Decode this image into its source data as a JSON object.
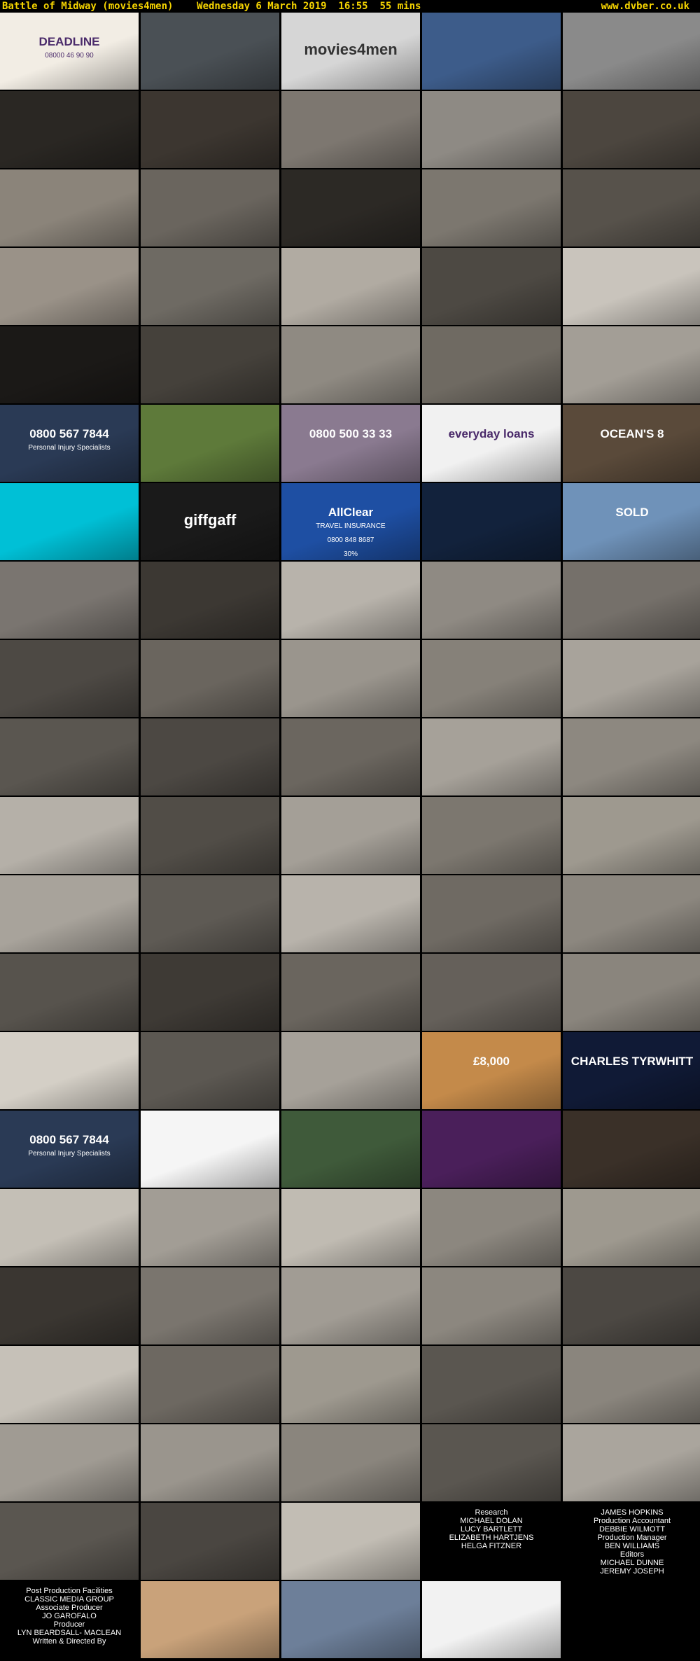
{
  "header": {
    "left": "Battle of Midway (movies4men)    Wednesday 6 March 2019  16:55  55 mins",
    "right": "www.dvber.co.uk"
  },
  "tiles": [
    {
      "bg": "#f2ede4",
      "kind": "deadline",
      "text": [
        "DEADLINE",
        "08000 46 90 90"
      ]
    },
    {
      "bg": "#4a5055"
    },
    {
      "bg": "#d6d6d6",
      "kind": "logo",
      "text": [
        "movies4men"
      ]
    },
    {
      "bg": "#3d5c8a"
    },
    {
      "bg": "#8a8a8a"
    },
    {
      "bg": "#2a2723"
    },
    {
      "bg": "#3c3630"
    },
    {
      "bg": "#7d7770"
    },
    {
      "bg": "#8e8a84"
    },
    {
      "bg": "#4c463f"
    },
    {
      "bg": "#8b847a"
    },
    {
      "bg": "#6a655e"
    },
    {
      "bg": "#2c2925"
    },
    {
      "bg": "#7c776f"
    },
    {
      "bg": "#57524b"
    },
    {
      "bg": "#9a9288"
    },
    {
      "bg": "#6e6a63"
    },
    {
      "bg": "#b1aba2"
    },
    {
      "bg": "#4d4943"
    },
    {
      "bg": "#c9c4bc"
    },
    {
      "bg": "#1b1917"
    },
    {
      "bg": "#45413b"
    },
    {
      "bg": "#8f8a82"
    },
    {
      "bg": "#6f6a62"
    },
    {
      "bg": "#a39e96"
    },
    {
      "bg": "#2a3a55",
      "kind": "phone",
      "text": [
        "0800 567 7844",
        "Personal Injury Specialists"
      ]
    },
    {
      "bg": "#5e7a3a"
    },
    {
      "bg": "#8a7a90",
      "kind": "cap",
      "text": [
        "0800 500 33 33"
      ]
    },
    {
      "bg": "#f1f1f1",
      "kind": "green",
      "text": [
        "everyday loans"
      ]
    },
    {
      "bg": "#5a4a3a",
      "kind": "cap",
      "text": [
        "OCEAN'S 8"
      ]
    },
    {
      "bg": "#00c0d6"
    },
    {
      "bg": "#1a1a1a",
      "kind": "logo",
      "text": [
        "giffgaff"
      ]
    },
    {
      "bg": "#1e4fa3",
      "kind": "allclear",
      "text": [
        "AllClear",
        "TRAVEL INSURANCE",
        "0800 848 8687",
        "30%"
      ]
    },
    {
      "bg": "#12223c"
    },
    {
      "bg": "#6f92b9",
      "kind": "cap",
      "text": [
        "SOLD"
      ]
    },
    {
      "bg": "#7a7570"
    },
    {
      "bg": "#3c3833"
    },
    {
      "bg": "#b8b3ab"
    },
    {
      "bg": "#8f8a83"
    },
    {
      "bg": "#75706a"
    },
    {
      "bg": "#4d4944"
    },
    {
      "bg": "#6a655e"
    },
    {
      "bg": "#9a958d"
    },
    {
      "bg": "#868179"
    },
    {
      "bg": "#a8a39b"
    },
    {
      "bg": "#5a5650"
    },
    {
      "bg": "#4c4843"
    },
    {
      "bg": "#6b665f"
    },
    {
      "bg": "#a6a199"
    },
    {
      "bg": "#8d8880"
    },
    {
      "bg": "#b5b0a8"
    },
    {
      "bg": "#514d47"
    },
    {
      "bg": "#a49f97"
    },
    {
      "bg": "#7c776f"
    },
    {
      "bg": "#9e998f"
    },
    {
      "bg": "#a8a39b"
    },
    {
      "bg": "#5e5a54"
    },
    {
      "bg": "#b8b3ab"
    },
    {
      "bg": "#6f6a63"
    },
    {
      "bg": "#8c877f"
    },
    {
      "bg": "#57534d"
    },
    {
      "bg": "#3e3a35"
    },
    {
      "bg": "#6a655e"
    },
    {
      "bg": "#65605a"
    },
    {
      "bg": "#8a857d"
    },
    {
      "bg": "#d4cfc6"
    },
    {
      "bg": "#5c5852"
    },
    {
      "bg": "#a6a199"
    },
    {
      "bg": "#c48a4a",
      "kind": "cap",
      "text": [
        "£8,000"
      ]
    },
    {
      "bg": "#101a36",
      "kind": "cap",
      "text": [
        "CHARLES TYRWHITT"
      ]
    },
    {
      "bg": "#2a3a55",
      "kind": "phone",
      "text": [
        "0800 567 7844",
        "Personal Injury Specialists"
      ]
    },
    {
      "bg": "#f5f5f5"
    },
    {
      "bg": "#3f5a3a"
    },
    {
      "bg": "#4a1f5a"
    },
    {
      "bg": "#3a3028"
    },
    {
      "bg": "#c4bfb6"
    },
    {
      "bg": "#a29d95"
    },
    {
      "bg": "#c0bbb2"
    },
    {
      "bg": "#8c877f"
    },
    {
      "bg": "#9e998f"
    },
    {
      "bg": "#3a3631"
    },
    {
      "bg": "#7a756e"
    },
    {
      "bg": "#a19c94"
    },
    {
      "bg": "#8c877f"
    },
    {
      "bg": "#4c4843"
    },
    {
      "bg": "#c6c1b8"
    },
    {
      "bg": "#6d6861"
    },
    {
      "bg": "#9e998f"
    },
    {
      "bg": "#5a5650"
    },
    {
      "bg": "#8a857d"
    },
    {
      "bg": "#a09b93"
    },
    {
      "bg": "#9a958d"
    },
    {
      "bg": "#8a857d"
    },
    {
      "bg": "#5a5650"
    },
    {
      "bg": "#aaa59d"
    },
    {
      "bg": "#5a5650"
    },
    {
      "bg": "#4a4641"
    },
    {
      "bg": "#c2bdb4"
    },
    {
      "bg": "#000000",
      "kind": "credits",
      "text": [
        "Research",
        "MICHAEL DOLAN",
        "LUCY BARTLETT",
        "ELIZABETH HARTJENS",
        "HELGA FITZNER"
      ]
    },
    {
      "bg": "#000000",
      "kind": "credits",
      "text": [
        "JAMES HOPKINS",
        "Production Accountant",
        "DEBBIE WILMOTT",
        "Production Manager",
        "BEN WILLIAMS",
        "Editors",
        "MICHAEL DUNNE",
        "JEREMY JOSEPH"
      ]
    },
    {
      "bg": "#000000",
      "kind": "credits",
      "text": [
        "Post Production Facilities",
        "CLASSIC MEDIA GROUP",
        "Associate Producer",
        "JO GAROFALO",
        "Producer",
        "LYN BEARDSALL- MACLEAN",
        "Written & Directed By"
      ]
    },
    {
      "bg": "#c9a27a"
    },
    {
      "bg": "#6d7f99"
    },
    {
      "bg": "#f2f2f2"
    }
  ]
}
